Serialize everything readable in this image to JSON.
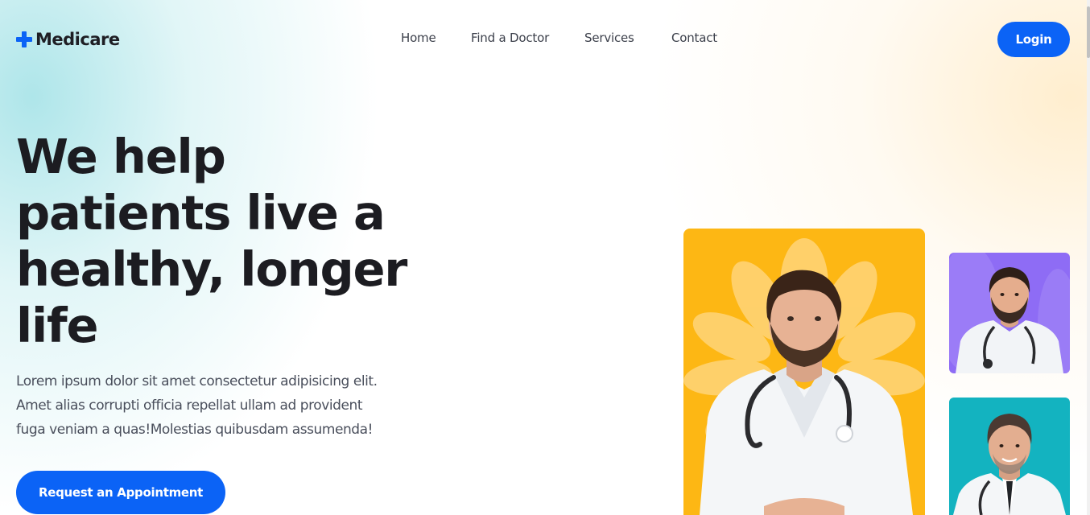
{
  "brand": {
    "name": "Medicare",
    "accent": "#0b63f6"
  },
  "nav": {
    "items": [
      "Home",
      "Find a Doctor",
      "Services",
      "Contact"
    ],
    "login_label": "Login"
  },
  "hero": {
    "title": "We help patients live a healthy, longer life",
    "description": "Lorem ipsum dolor sit amet consectetur adipisicing elit. Amet alias corrupti officia repellat ullam ad provident fuga veniam a quas!Molestias quibusdam assumenda!",
    "cta_label": "Request an Appointment"
  },
  "doctors": {
    "main_bg": "#fdb714",
    "small1_bg": "#8e6cf5",
    "small2_bg": "#13b3c0"
  }
}
